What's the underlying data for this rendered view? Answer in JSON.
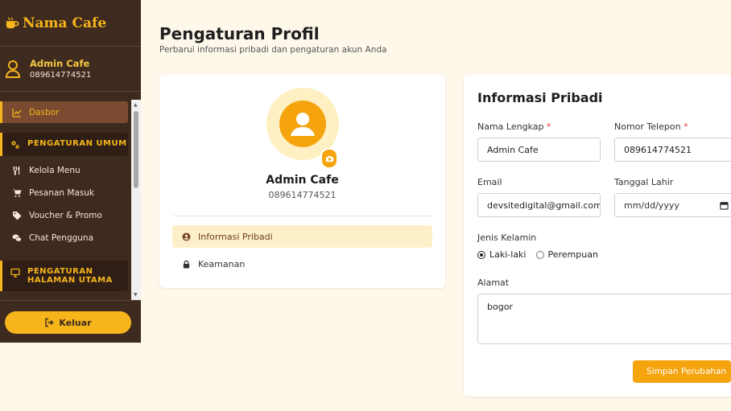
{
  "sidebar": {
    "brand": "Nama Cafe",
    "user": {
      "name": "Admin Cafe",
      "phone": "089614774521"
    },
    "menu": {
      "dashboard": "Dasbor",
      "general_settings": "PENGATURAN UMUM",
      "manage_menu": "Kelola Menu",
      "incoming_orders": "Pesanan Masuk",
      "voucher_promo": "Voucher & Promo",
      "user_chat": "Chat Pengguna",
      "homepage_settings": "PENGATURAN HALAMAN UTAMA"
    },
    "logout": "Keluar"
  },
  "header": {
    "title": "Pengaturan Profil",
    "subtitle": "Perbarui informasi pribadi dan pengaturan akun Anda"
  },
  "profile_card": {
    "name": "Admin Cafe",
    "phone": "089614774521",
    "tabs": {
      "personal": "Informasi Pribadi",
      "security": "Keamanan"
    }
  },
  "form": {
    "title": "Informasi Pribadi",
    "full_name": {
      "label": "Nama Lengkap",
      "value": "Admin Cafe"
    },
    "phone": {
      "label": "Nomor Telepon",
      "value": "089614774521"
    },
    "email": {
      "label": "Email",
      "value": "devsitedigital@gmail.com"
    },
    "birth_date": {
      "label": "Tanggal Lahir",
      "value": "mm/dd/yyyy"
    },
    "gender": {
      "label": "Jenis Kelamin",
      "male": "Laki-laki",
      "female": "Perempuan",
      "selected": "Laki-laki"
    },
    "address": {
      "label": "Alamat",
      "value": "bogor"
    },
    "required_mark": "*",
    "save": "Simpan Perubahan"
  },
  "colors": {
    "sidebar_bg": "#3e2a1f",
    "accent": "#f5b51b",
    "primary_button": "#f5a40e",
    "page_bg": "#fdf8ea"
  }
}
